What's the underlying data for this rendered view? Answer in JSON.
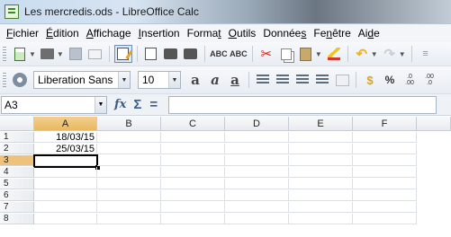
{
  "window": {
    "title": "Les mercredis.ods - LibreOffice Calc"
  },
  "menu": [
    {
      "pre": "",
      "u": "F",
      "post": "ichier"
    },
    {
      "pre": "",
      "u": "É",
      "post": "dition"
    },
    {
      "pre": "",
      "u": "A",
      "post": "ffichage"
    },
    {
      "pre": "",
      "u": "I",
      "post": "nsertion"
    },
    {
      "pre": "Forma",
      "u": "t",
      "post": ""
    },
    {
      "pre": "",
      "u": "O",
      "post": "utils"
    },
    {
      "pre": "Donnée",
      "u": "s",
      "post": ""
    },
    {
      "pre": "Fe",
      "u": "n",
      "post": "être"
    },
    {
      "pre": "Ai",
      "u": "d",
      "post": "e"
    }
  ],
  "formatting": {
    "font_name": "Liberation Sans",
    "font_size": "10"
  },
  "formula_bar": {
    "cell_ref": "A3",
    "content": ""
  },
  "sheet": {
    "columns": [
      "A",
      "B",
      "C",
      "D",
      "E",
      "F"
    ],
    "rows": [
      "1",
      "2",
      "3",
      "4",
      "5",
      "6",
      "7",
      "8"
    ],
    "cells": {
      "A1": "18/03/15",
      "A2": "25/03/15"
    },
    "active_cell": "A3"
  },
  "icons": {
    "bold": "a",
    "italic": "a",
    "underline": "a",
    "currency": "$",
    "percent": "%",
    "fx": "fx",
    "sum": "Σ",
    "equals": "="
  }
}
